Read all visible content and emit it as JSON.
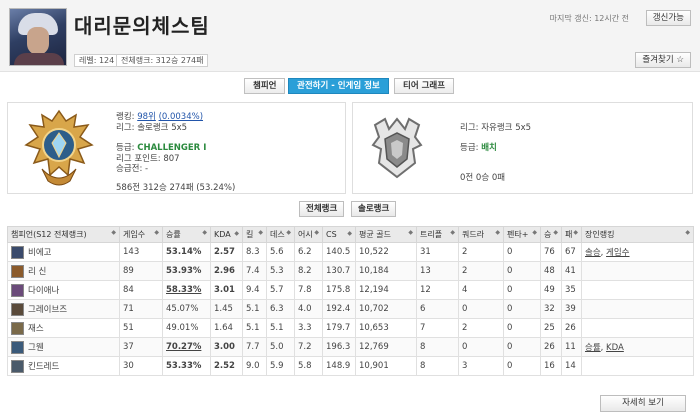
{
  "profile": {
    "name": "대리문의체스팀",
    "level": "레벨: 124",
    "overall_rank": "전체랭크: 312승 274패",
    "last_update": "마지막 갱신: 12시간 전",
    "refresh_label": "갱신가능",
    "favorite_label": "즐겨찾기 ☆"
  },
  "tabs": [
    {
      "label": "챔피언"
    },
    {
      "label": "관전하기 - 인게임 정보"
    },
    {
      "label": "티어 그래프"
    }
  ],
  "solo_rank": {
    "rank_prefix": "랭킹: ",
    "rank_value": "98위",
    "rank_pct": "(0.0034%)",
    "league": "리그: 솔로랭크 5x5",
    "tier_prefix": "등급: ",
    "tier": "CHALLENGER I",
    "points": "리그 포인트: 807",
    "promo": "승급전: -",
    "record": "586전 312승 274패 (53.24%)"
  },
  "flex_rank": {
    "league": "리그: 자유랭크 5x5",
    "tier_prefix": "등급: ",
    "tier": "배치",
    "record": "0전 0승 0패"
  },
  "sub_tabs": [
    {
      "label": "전체랭크"
    },
    {
      "label": "솔로랭크"
    }
  ],
  "table": {
    "headers": [
      "챔피언(S12 전체랭크)",
      "게임수",
      "승률",
      "KDA",
      "킬",
      "데스",
      "어시",
      "CS",
      "평균 골드",
      "트리플",
      "쿼드라",
      "펜타+",
      "승",
      "패",
      "장인랭킹"
    ],
    "rows": [
      {
        "champ": "비에고",
        "games": "143",
        "wr": "53.14%",
        "wr_style": "blue",
        "kda": "2.57",
        "kda_style": "green",
        "k": "8.3",
        "d": "5.6",
        "a": "6.2",
        "cs": "140.5",
        "gold": "10,522",
        "triple": "31",
        "quadra": "2",
        "penta": "0",
        "w": "76",
        "l": "67",
        "badges": [
          "솔승",
          "게임수"
        ],
        "color": "#3a4a6b"
      },
      {
        "champ": "리 신",
        "games": "89",
        "wr": "53.93%",
        "wr_style": "blue",
        "kda": "2.96",
        "kda_style": "green",
        "k": "7.4",
        "d": "5.3",
        "a": "8.2",
        "cs": "130.7",
        "gold": "10,184",
        "triple": "13",
        "quadra": "2",
        "penta": "0",
        "w": "48",
        "l": "41",
        "badges": [],
        "color": "#8a5a2b"
      },
      {
        "champ": "다이애나",
        "games": "84",
        "wr": "58.33%",
        "wr_style": "red",
        "kda": "3.01",
        "kda_style": "blue",
        "k": "9.4",
        "d": "5.7",
        "a": "7.8",
        "cs": "175.8",
        "gold": "12,194",
        "triple": "12",
        "quadra": "4",
        "penta": "0",
        "w": "49",
        "l": "35",
        "badges": [],
        "color": "#6b4b7a"
      },
      {
        "champ": "그레이브즈",
        "games": "71",
        "wr": "45.07%",
        "wr_style": "gray",
        "kda": "1.45",
        "kda_style": "gray",
        "k": "5.1",
        "d": "6.3",
        "a": "4.0",
        "cs": "192.4",
        "gold": "10,702",
        "triple": "6",
        "quadra": "0",
        "penta": "0",
        "w": "32",
        "l": "39",
        "badges": [],
        "color": "#5a4a3a"
      },
      {
        "champ": "재스",
        "games": "51",
        "wr": "49.01%",
        "wr_style": "plain",
        "kda": "1.64",
        "kda_style": "gray",
        "k": "5.1",
        "d": "5.1",
        "a": "3.3",
        "cs": "179.7",
        "gold": "10,653",
        "triple": "7",
        "quadra": "2",
        "penta": "0",
        "w": "25",
        "l": "26",
        "badges": [],
        "color": "#7a6a4a"
      },
      {
        "champ": "그웬",
        "games": "37",
        "wr": "70.27%",
        "wr_style": "red",
        "kda": "3.00",
        "kda_style": "blue",
        "k": "7.7",
        "d": "5.0",
        "a": "7.2",
        "cs": "196.3",
        "gold": "12,769",
        "triple": "8",
        "quadra": "0",
        "penta": "0",
        "w": "26",
        "l": "11",
        "badges": [
          "승률",
          "KDA"
        ],
        "color": "#3a5a7a"
      },
      {
        "champ": "킨드레드",
        "games": "30",
        "wr": "53.33%",
        "wr_style": "blue",
        "kda": "2.52",
        "kda_style": "green",
        "k": "9.0",
        "d": "5.9",
        "a": "5.8",
        "cs": "148.9",
        "gold": "10,901",
        "triple": "8",
        "quadra": "3",
        "penta": "0",
        "w": "16",
        "l": "14",
        "badges": [],
        "color": "#4a5a6a"
      }
    ]
  },
  "more_label": "자세히 보기"
}
